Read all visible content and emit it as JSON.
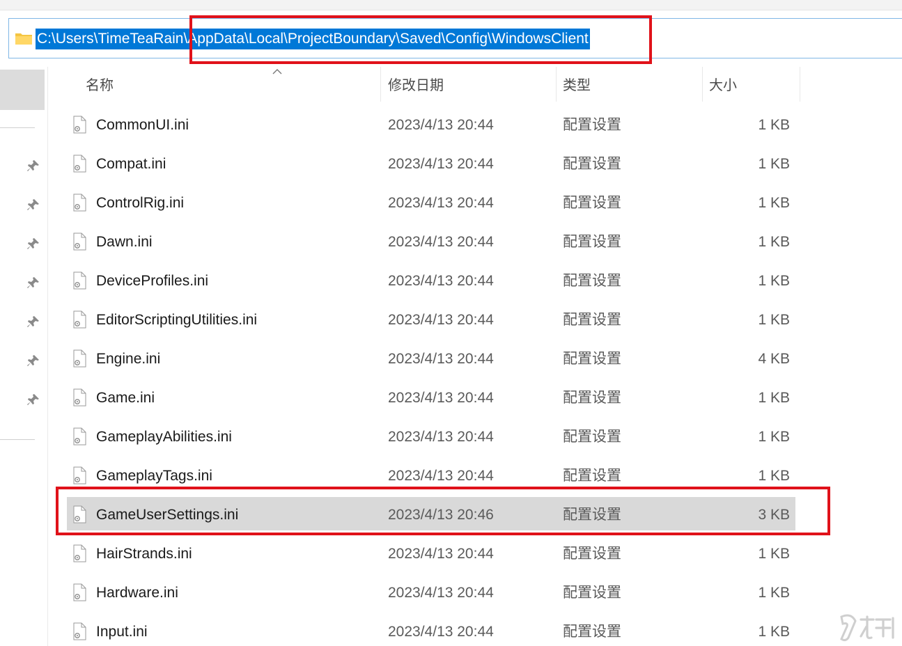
{
  "address_bar": {
    "path": "C:\\Users\\TimeTeaRain\\AppData\\Local\\ProjectBoundary\\Saved\\Config\\WindowsClient"
  },
  "columns": {
    "name": "名称",
    "date": "修改日期",
    "type": "类型",
    "size": "大小"
  },
  "files": [
    {
      "name": "CommonUI.ini",
      "date": "2023/4/13 20:44",
      "type": "配置设置",
      "size": "1 KB"
    },
    {
      "name": "Compat.ini",
      "date": "2023/4/13 20:44",
      "type": "配置设置",
      "size": "1 KB"
    },
    {
      "name": "ControlRig.ini",
      "date": "2023/4/13 20:44",
      "type": "配置设置",
      "size": "1 KB"
    },
    {
      "name": "Dawn.ini",
      "date": "2023/4/13 20:44",
      "type": "配置设置",
      "size": "1 KB"
    },
    {
      "name": "DeviceProfiles.ini",
      "date": "2023/4/13 20:44",
      "type": "配置设置",
      "size": "1 KB"
    },
    {
      "name": "EditorScriptingUtilities.ini",
      "date": "2023/4/13 20:44",
      "type": "配置设置",
      "size": "1 KB"
    },
    {
      "name": "Engine.ini",
      "date": "2023/4/13 20:44",
      "type": "配置设置",
      "size": "4 KB"
    },
    {
      "name": "Game.ini",
      "date": "2023/4/13 20:44",
      "type": "配置设置",
      "size": "1 KB"
    },
    {
      "name": "GameplayAbilities.ini",
      "date": "2023/4/13 20:44",
      "type": "配置设置",
      "size": "1 KB"
    },
    {
      "name": "GameplayTags.ini",
      "date": "2023/4/13 20:44",
      "type": "配置设置",
      "size": "1 KB"
    },
    {
      "name": "GameUserSettings.ini",
      "date": "2023/4/13 20:46",
      "type": "配置设置",
      "size": "3 KB"
    },
    {
      "name": "HairStrands.ini",
      "date": "2023/4/13 20:44",
      "type": "配置设置",
      "size": "1 KB"
    },
    {
      "name": "Hardware.ini",
      "date": "2023/4/13 20:44",
      "type": "配置设置",
      "size": "1 KB"
    },
    {
      "name": "Input.ini",
      "date": "2023/4/13 20:44",
      "type": "配置设置",
      "size": "1 KB"
    }
  ],
  "selected_file": "GameUserSettings.ini",
  "watermark": "九游",
  "colors": {
    "address_selection": "#0078d7",
    "highlight_box": "#e0121a",
    "selected_row": "#d9d9d9"
  }
}
